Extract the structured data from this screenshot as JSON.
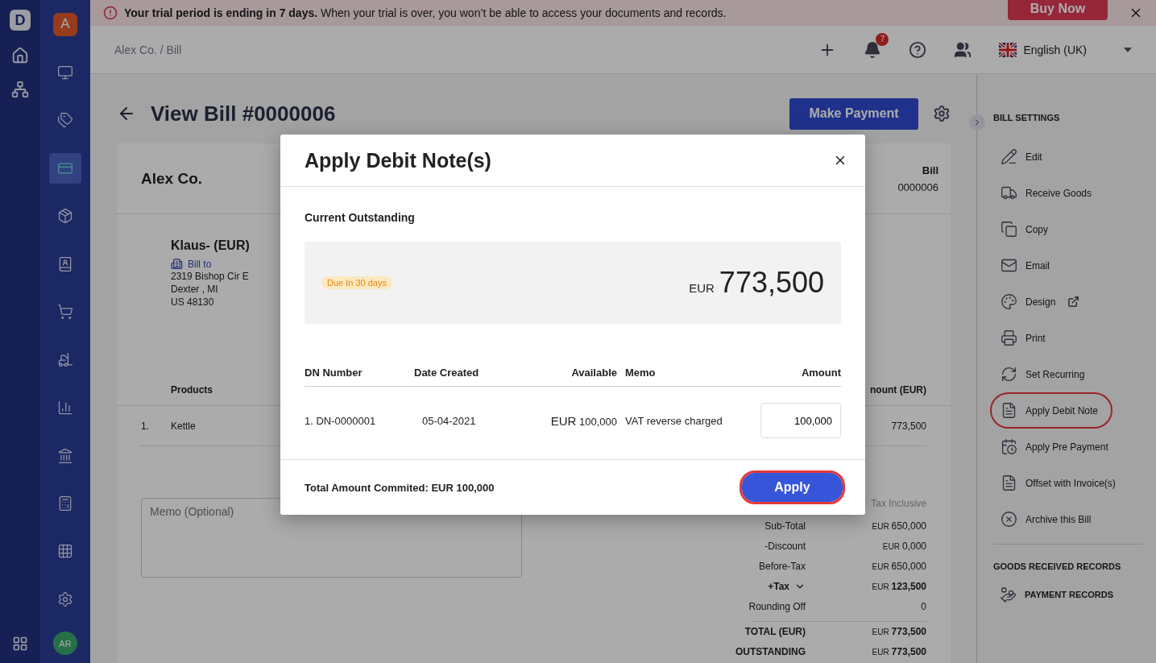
{
  "app_rail": {
    "logo": "D",
    "avatar": "AR"
  },
  "nav_rail": {
    "org": "A",
    "items": [
      {
        "selected": false
      },
      {
        "selected": false
      },
      {
        "selected": true
      },
      {
        "selected": false
      },
      {
        "selected": false
      },
      {
        "selected": false
      },
      {
        "selected": false
      },
      {
        "selected": false
      },
      {
        "selected": false
      },
      {
        "selected": false
      },
      {
        "selected": false
      },
      {
        "selected": false
      }
    ]
  },
  "banner": {
    "message": "**Your trial period is ending in 7 days.** When your trial is over, you won’t be able to access your documents and records.",
    "button": "Buy Now"
  },
  "header": {
    "breadcrumb": "Alex Co. / Bill",
    "notifications": "7",
    "language": "English (UK)"
  },
  "page": {
    "title": "View Bill #0000006",
    "primary_button": "Make Payment"
  },
  "bill": {
    "company": "Alex Co.",
    "doc_label": "Bill",
    "doc_number": "0000006",
    "vendor": {
      "name": "Klaus- (EUR)",
      "bill_to": "Bill to",
      "address": [
        "2319 Bishop Cir E",
        "Dexter , MI",
        "US 48130"
      ]
    },
    "columns": [
      "Products",
      "nount (EUR)"
    ],
    "rows": [
      {
        "index": "1.",
        "product": "Kettle",
        "amount": "773,500"
      }
    ],
    "memo": {
      "placeholder": "Memo (Optional)"
    },
    "tax_mode": "Tax Inclusive",
    "totals": [
      {
        "label": "Sub-Total",
        "currency": "EUR",
        "value": "650,000",
        "bold": false
      },
      {
        "label": "-Discount",
        "currency": "EUR",
        "value": "0,000",
        "bold": false
      },
      {
        "label": "Before-Tax",
        "currency": "EUR",
        "value": "650,000",
        "bold": false
      },
      {
        "label": "+Tax",
        "currency": "EUR",
        "value": "123,500",
        "bold": true,
        "expandable": true
      },
      {
        "label": "Rounding Off",
        "value": "0",
        "bold": false
      },
      {
        "label": "TOTAL (EUR)",
        "currency": "EUR",
        "value": "773,500",
        "bold": true,
        "divider": true
      },
      {
        "label": "OUTSTANDING",
        "currency": "EUR",
        "value": "773,500",
        "bold": true
      }
    ]
  },
  "settings_panel": {
    "title": "BILL SETTINGS",
    "items": [
      {
        "kind": "edit",
        "label": "Edit",
        "highlighted": false
      },
      {
        "kind": "truck",
        "label": "Receive Goods",
        "highlighted": false
      },
      {
        "kind": "copy",
        "label": "Copy",
        "highlighted": false
      },
      {
        "kind": "mail",
        "label": "Email",
        "highlighted": false
      },
      {
        "kind": "palette",
        "label": "Design",
        "highlighted": false,
        "external": true
      },
      {
        "kind": "print",
        "label": "Print",
        "highlighted": false
      },
      {
        "kind": "recurring",
        "label": "Set Recurring",
        "highlighted": false
      },
      {
        "kind": "note",
        "label": "Apply Debit Note",
        "highlighted": true
      },
      {
        "kind": "calendar",
        "label": "Apply Pre Payment",
        "highlighted": false
      },
      {
        "kind": "note",
        "label": "Offset with Invoice(s)",
        "highlighted": false
      },
      {
        "kind": "archive",
        "label": "Archive this Bill",
        "highlighted": false
      }
    ],
    "sections": [
      "GOODS RECEIVED RECORDS",
      "PAYMENT RECORDS"
    ]
  },
  "modal": {
    "title": "Apply Debit Note(s)",
    "subtitle": "Current Outstanding",
    "due_badge": "Due In 30 days",
    "currency": "EUR",
    "outstanding": "773,500",
    "columns": [
      "DN Number",
      "Date Created",
      "Available",
      "Memo",
      "Amount"
    ],
    "rows": [
      {
        "number": "1. DN-0000001",
        "date": "05-04-2021",
        "currency": "EUR",
        "available": "100,000",
        "memo": "VAT reverse charged",
        "amount": "100,000"
      }
    ],
    "total": "Total Amount Commited: EUR 100,000",
    "button": "Apply",
    "button_highlighted": true
  }
}
